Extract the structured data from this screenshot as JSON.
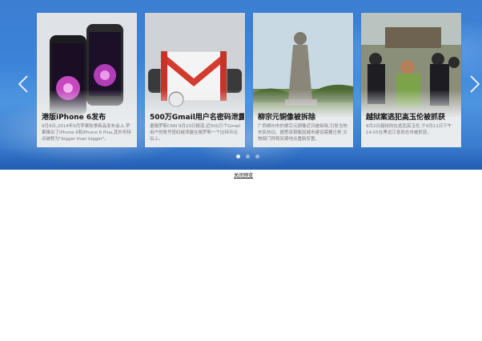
{
  "carousel": {
    "slides": [
      {
        "title": "港版iPhone 6发布",
        "desc": "9月9日,2014年9月苹果秋季新品发布会上,苹果推出了iPhone 6和iPhone 6 Plus,其外形特点被称为\"bigger than bigger\"。",
        "image": "iphone-photo"
      },
      {
        "title": "500万Gmail用户名密码泄露",
        "desc": "据俄罗斯CNN 9月10日报道,近500万个Gmail用户的账号密码被泄露在俄罗斯一个比特币论坛上。",
        "image": "gmail-logo-photo"
      },
      {
        "title": "柳宗元铜像被拆除",
        "desc": "广西柳州市的柳宗元铜像近日被拆除,引发当地市民热议。据悉该铜像因城市建设需要迁移,文物部门称将另择地点重新安置。",
        "image": "statue-photo"
      },
      {
        "title": "越狱案逃犯高玉伦被抓获",
        "desc": "9月2日越狱的在逃犯高玉伦,于9月11日下午14:05在黑龙江省尚志市被抓获。",
        "image": "arrest-photo"
      }
    ],
    "dots": 3,
    "active_dot": 0
  },
  "footer": {
    "close_label": "关闭预览"
  },
  "colors": {
    "background_top": "#3b7fd2",
    "background_bottom": "#2f6ec4",
    "card_bg": "#e9ecef"
  }
}
